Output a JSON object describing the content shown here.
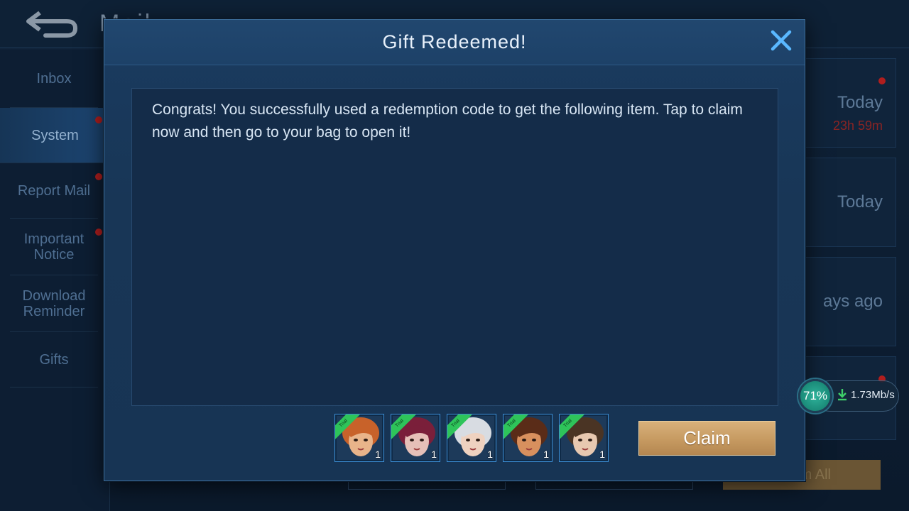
{
  "background": {
    "title": "Mail",
    "sidebar": [
      {
        "label": "Inbox",
        "active": false
      },
      {
        "label": "System",
        "active": true
      },
      {
        "label": "Report Mail",
        "active": false
      },
      {
        "label": "Important Notice",
        "active": false
      },
      {
        "label": "Download Reminder",
        "active": false
      },
      {
        "label": "Gifts",
        "active": false
      }
    ],
    "mail_list": [
      {
        "date": "Today",
        "expire": "23h 59m"
      },
      {
        "date": "Today",
        "expire": ""
      },
      {
        "date": "ays ago",
        "expire": ""
      }
    ],
    "claim_all_label": "m All"
  },
  "dialog": {
    "title": "Gift Redeemed!",
    "message": "Congrats! You successfully used a redemption code to get the following item. Tap to claim now and then go to your bag to open it!",
    "rewards": [
      {
        "name": "hero-trial-card-1",
        "badge": "Trial",
        "qty": "1",
        "hair": "#c8622a",
        "skin": "#e9b48a"
      },
      {
        "name": "hero-trial-card-2",
        "badge": "Trial",
        "qty": "1",
        "hair": "#7a1f3a",
        "skin": "#e6c0b8"
      },
      {
        "name": "hero-trial-card-3",
        "badge": "Trial",
        "qty": "1",
        "hair": "#d8dce2",
        "skin": "#efd2c0"
      },
      {
        "name": "hero-trial-card-4",
        "badge": "Trial",
        "qty": "1",
        "hair": "#5a2c18",
        "skin": "#d8905e"
      },
      {
        "name": "hero-trial-card-5",
        "badge": "Trial",
        "qty": "1",
        "hair": "#4a3424",
        "skin": "#e8c8b0"
      }
    ],
    "claim_label": "Claim"
  },
  "network": {
    "percent": "71%",
    "speed": "1.73Mb/s"
  },
  "colors": {
    "accent": "#3c8fd6",
    "claim_button": "#c69a61",
    "trial_badge": "#2ec45a"
  }
}
